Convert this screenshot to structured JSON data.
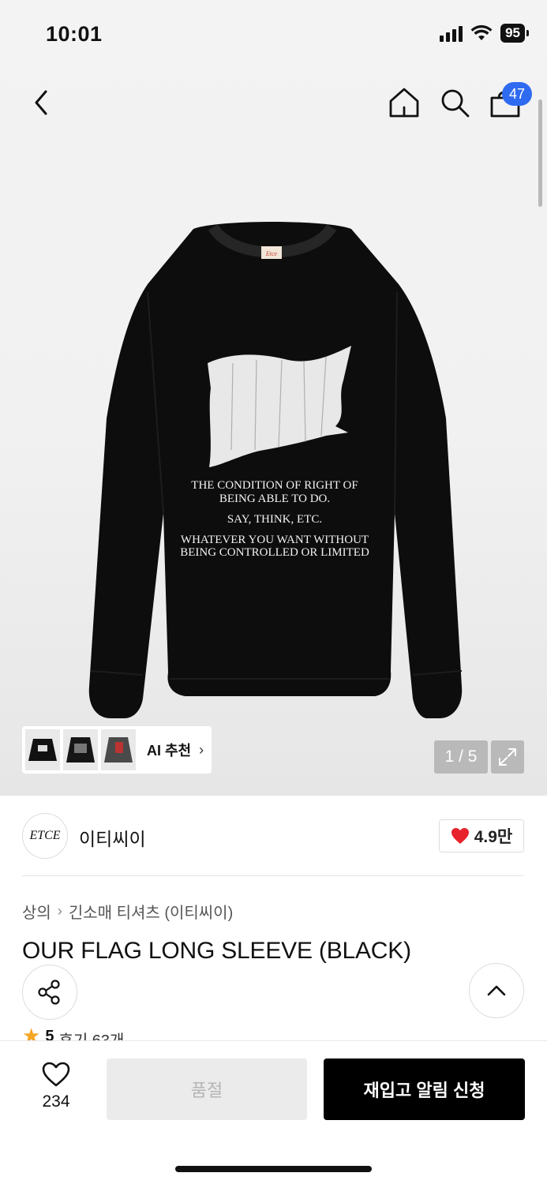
{
  "status_bar": {
    "time": "10:01",
    "battery": "95"
  },
  "header": {
    "cart_count": "47"
  },
  "gallery": {
    "print_text": [
      "THE CONDITION OF RIGHT OF",
      "BEING ABLE TO DO.",
      "SAY,      THINK,      ETC.",
      "WHATEVER YOU WANT WITHOUT",
      "BEING CONTROLLED OR LIMITED"
    ],
    "label_text": "Etce",
    "ai_recommend_label": "AI 추천",
    "pager": "1 / 5"
  },
  "brand": {
    "logo_text": "ETCE",
    "name": "이티씨이",
    "likes": "4.9만"
  },
  "breadcrumb": {
    "category": "상의",
    "subcategory": "긴소매 티셔츠 (이티씨이)"
  },
  "product": {
    "title": "OUR FLAG LONG SLEEVE (BLACK)"
  },
  "rating": {
    "score": "5",
    "reviews": "후기 63개"
  },
  "bottom_bar": {
    "wish_count": "234",
    "soldout_label": "품절",
    "restock_label": "재입고 알림 신청"
  },
  "colors": {
    "badge": "#2e6bf0",
    "heart": "#e8222b",
    "star": "#f5a623",
    "cta": "#000000",
    "disabled": "#ebebeb"
  }
}
